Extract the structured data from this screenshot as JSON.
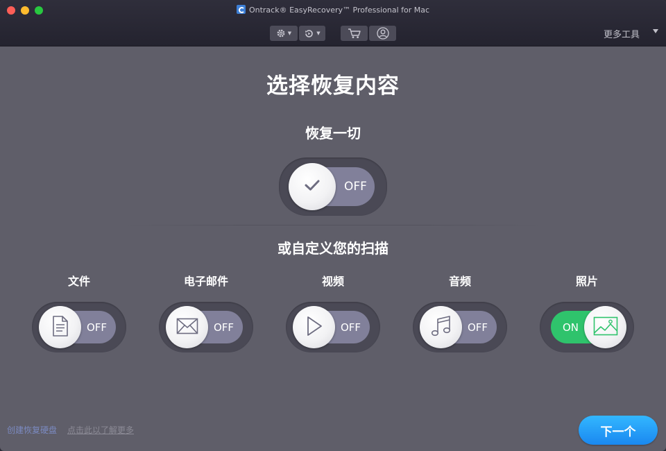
{
  "window": {
    "title": "Ontrack® EasyRecovery™ Professional for Mac"
  },
  "toolbar": {
    "more_tools": "更多工具",
    "icons": [
      "gear-icon",
      "history-icon",
      "cart-icon",
      "account-icon"
    ]
  },
  "main": {
    "title": "选择恢复内容",
    "recover_all": {
      "label": "恢复一切",
      "state": "OFF"
    },
    "custom_label": "或自定义您的扫描",
    "categories": [
      {
        "label": "文件",
        "state": "OFF",
        "icon": "document-icon"
      },
      {
        "label": "电子邮件",
        "state": "OFF",
        "icon": "envelope-icon"
      },
      {
        "label": "视频",
        "state": "OFF",
        "icon": "play-icon"
      },
      {
        "label": "音频",
        "state": "OFF",
        "icon": "music-note-icon"
      },
      {
        "label": "照片",
        "state": "ON",
        "icon": "photo-icon"
      }
    ]
  },
  "footer": {
    "create_disk": "创建恢复硬盘",
    "learn_more": "点击此以了解更多",
    "next": "下一个"
  },
  "colors": {
    "background": "#5f5e69",
    "titlebar": "#2a2935",
    "toggle_off": "#81809a",
    "toggle_on": "#2fc36c",
    "accent_button": "#1f96f5"
  }
}
